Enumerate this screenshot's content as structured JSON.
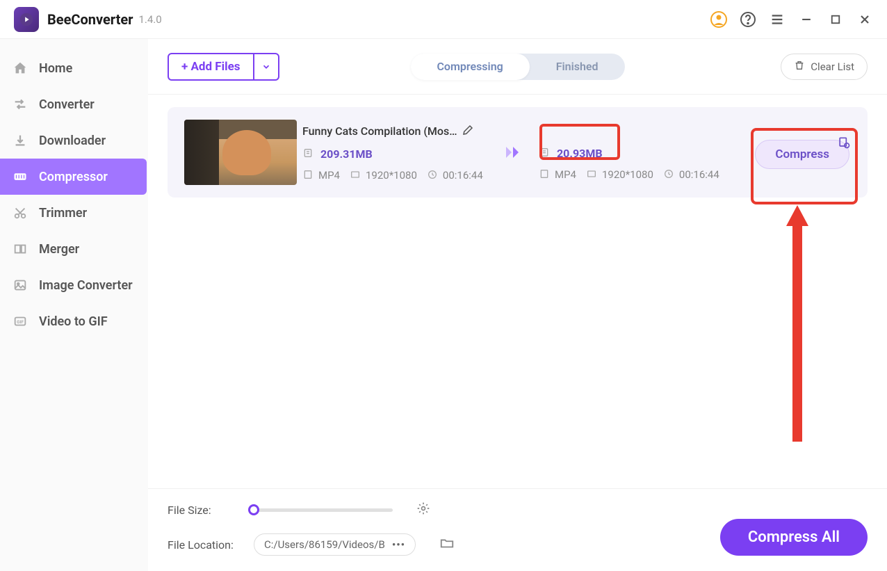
{
  "app": {
    "name": "BeeConverter",
    "version": "1.4.0"
  },
  "sidebar": {
    "items": [
      {
        "label": "Home"
      },
      {
        "label": "Converter"
      },
      {
        "label": "Downloader"
      },
      {
        "label": "Compressor"
      },
      {
        "label": "Trimmer"
      },
      {
        "label": "Merger"
      },
      {
        "label": "Image Converter"
      },
      {
        "label": "Video to GIF"
      }
    ]
  },
  "toolbar": {
    "add_files": "+ Add Files",
    "tabs": {
      "compressing": "Compressing",
      "finished": "Finished"
    },
    "clear_list": "Clear List"
  },
  "file": {
    "title": "Funny Cats Compilation (Mos…",
    "source": {
      "size": "209.31MB",
      "format": "MP4",
      "resolution": "1920*1080",
      "duration": "00:16:44"
    },
    "target": {
      "size": "20.93MB",
      "format": "MP4",
      "resolution": "1920*1080",
      "duration": "00:16:44"
    },
    "compress_btn": "Compress"
  },
  "bottom": {
    "file_size_label": "File Size:",
    "file_location_label": "File Location:",
    "location_path": "C:/Users/86159/Videos/B",
    "compress_all": "Compress All"
  }
}
